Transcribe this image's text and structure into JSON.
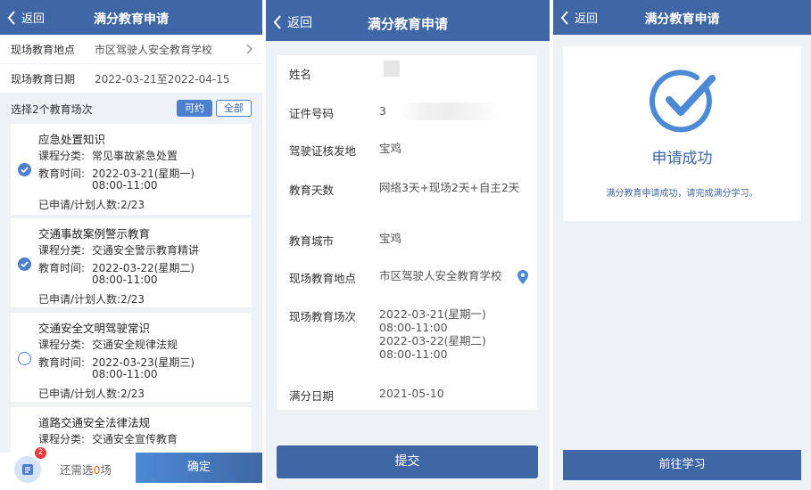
{
  "colors": {
    "nav": "#3f67a5",
    "accent": "#4d7fcf",
    "page_bg": "#eef1f5",
    "badge": "#e83c3c",
    "highlight": "#e8672b"
  },
  "panel1": {
    "back_label": "返回",
    "title": "满分教育申请",
    "location_label": "现场教育地点",
    "location_value": "市区驾驶人安全教育学校",
    "date_label": "现场教育日期",
    "date_value": "2022-03-21至2022-04-15",
    "select_heading": "选择2个教育场次",
    "filter_available": "可约",
    "filter_all": "全部",
    "course_type_label": "课程分类:",
    "time_label": "教育时间:",
    "count_label": "已申请/计划人数:",
    "sessions": [
      {
        "title": "应急处置知识",
        "type": "常见事故紧急处置",
        "date": "2022-03-21(星期一)",
        "time": "08:00-11:00",
        "count": "2/23",
        "selected": true
      },
      {
        "title": "交通事故案例警示教育",
        "type": "交通安全警示教育精讲",
        "date": "2022-03-22(星期二)",
        "time": "08:00-11:00",
        "count": "2/23",
        "selected": true
      },
      {
        "title": "交通安全文明驾驶常识",
        "type": "交通安全规律法规",
        "date": "2022-03-23(星期三)",
        "time": "08:00-11:00",
        "count": "2/23",
        "selected": false
      },
      {
        "title": "道路交通安全法律法规",
        "type": "交通安全宣传教育",
        "selected": false
      }
    ],
    "cart_badge": "2",
    "remain_prefix": "还需选",
    "remain_count": "0",
    "remain_suffix": "场",
    "confirm_label": "确定"
  },
  "panel2": {
    "back_label": "返回",
    "title": "满分教育申请",
    "name_label": "姓名",
    "id_label": "证件号码",
    "id_value_visible": "3",
    "license_place_label": "驾驶证核发地",
    "license_place_value": "宝鸡",
    "days_label": "教育天数",
    "days_value": "网络3天+现场2天+自主2天",
    "city_label": "教育城市",
    "city_value": "宝鸡",
    "site_label": "现场教育地点",
    "site_value": "市区驾驶人安全教育学校",
    "sessions_label": "现场教育场次",
    "session_lines": [
      "2022-03-21(星期一)",
      "08:00-11:00",
      "2022-03-22(星期二)",
      "08:00-11:00"
    ],
    "full_date_label": "满分日期",
    "full_date_value": "2021-05-10",
    "submit_label": "提交"
  },
  "panel3": {
    "back_label": "返回",
    "title": "满分教育申请",
    "success_title": "申请成功",
    "success_message": "满分教育申请成功，请完成满分学习。",
    "study_label": "前往学习"
  }
}
